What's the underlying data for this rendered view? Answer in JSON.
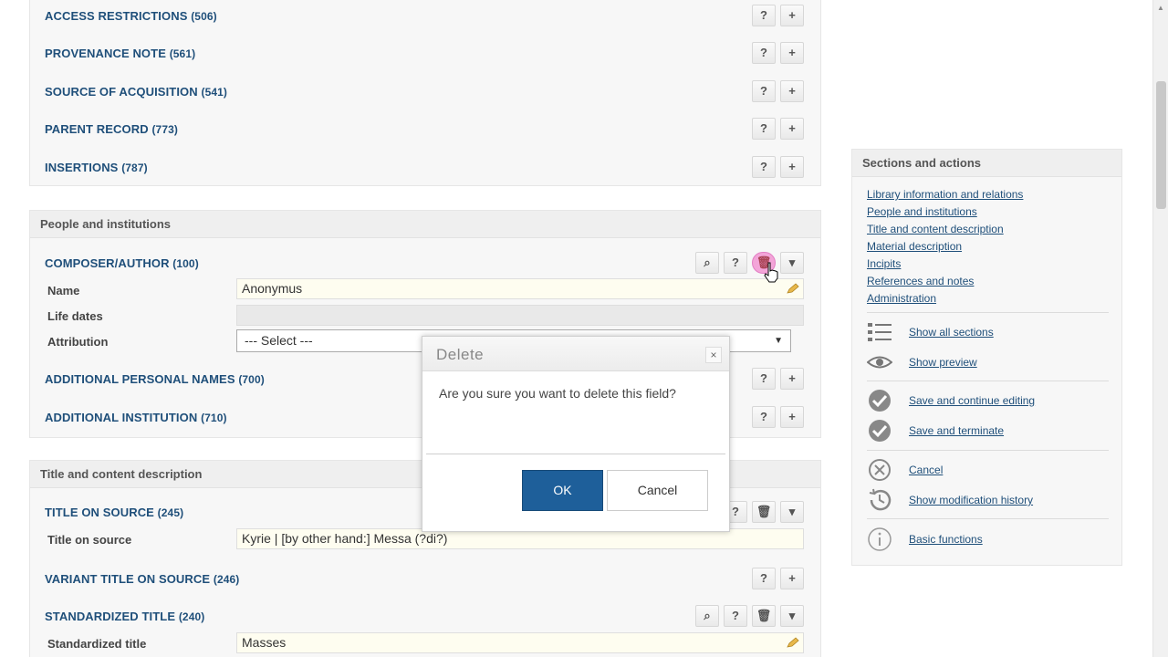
{
  "panel_top": {
    "rows": [
      {
        "name": "ACCESS RESTRICTIONS",
        "code": "(506)"
      },
      {
        "name": "PROVENANCE NOTE",
        "code": "(561)"
      },
      {
        "name": "SOURCE OF ACQUISITION",
        "code": "(541)"
      },
      {
        "name": "PARENT RECORD",
        "code": "(773)"
      },
      {
        "name": "INSERTIONS",
        "code": "(787)"
      }
    ]
  },
  "panel_people": {
    "header": "People and institutions",
    "composer": {
      "name": "COMPOSER/AUTHOR",
      "code": "(100)"
    },
    "fields": {
      "name_label": "Name",
      "name_value": "Anonymus",
      "life_dates_label": "Life dates",
      "life_dates_value": "",
      "attribution_label": "Attribution",
      "attribution_value": "--- Select ---"
    },
    "additional_personal": {
      "name": "ADDITIONAL PERSONAL NAMES",
      "code": "(700)"
    },
    "additional_institution": {
      "name": "ADDITIONAL INSTITUTION",
      "code": "(710)"
    }
  },
  "panel_title": {
    "header": "Title and content description",
    "title_on_source": {
      "name": "TITLE ON SOURCE",
      "code": "(245)"
    },
    "title_on_source_label": "Title on source",
    "title_on_source_value": "Kyrie | [by other hand:] Messa (?di?)",
    "variant_title": {
      "name": "VARIANT TITLE ON SOURCE",
      "code": "(246)"
    },
    "standardized_title": {
      "name": "STANDARDIZED TITLE",
      "code": "(240)"
    },
    "standardized_title_label": "Standardized title",
    "standardized_title_value": "Masses"
  },
  "buttons": {
    "help": "?",
    "add": "+",
    "delete": "🗑",
    "dropdown": "▾",
    "search": "⌕"
  },
  "sidebar": {
    "header": "Sections and actions",
    "links": [
      "Library information and relations",
      "People and institutions",
      "Title and content description",
      "Material description",
      "Incipits",
      "References and notes",
      "Administration"
    ],
    "actions": {
      "show_all": "Show all sections",
      "show_preview": "Show preview",
      "save_continue": "Save and continue editing",
      "save_terminate": "Save and terminate",
      "cancel": "Cancel",
      "history": "Show modification history",
      "basic": "Basic functions"
    }
  },
  "dialog": {
    "title": "Delete",
    "close": "×",
    "message": "Are you sure you want to delete this field?",
    "ok": "OK",
    "cancel": "Cancel"
  },
  "colors": {
    "accent": "#1e5f9a",
    "link": "#1f4f7a",
    "highlight": "#f3a4d8"
  }
}
